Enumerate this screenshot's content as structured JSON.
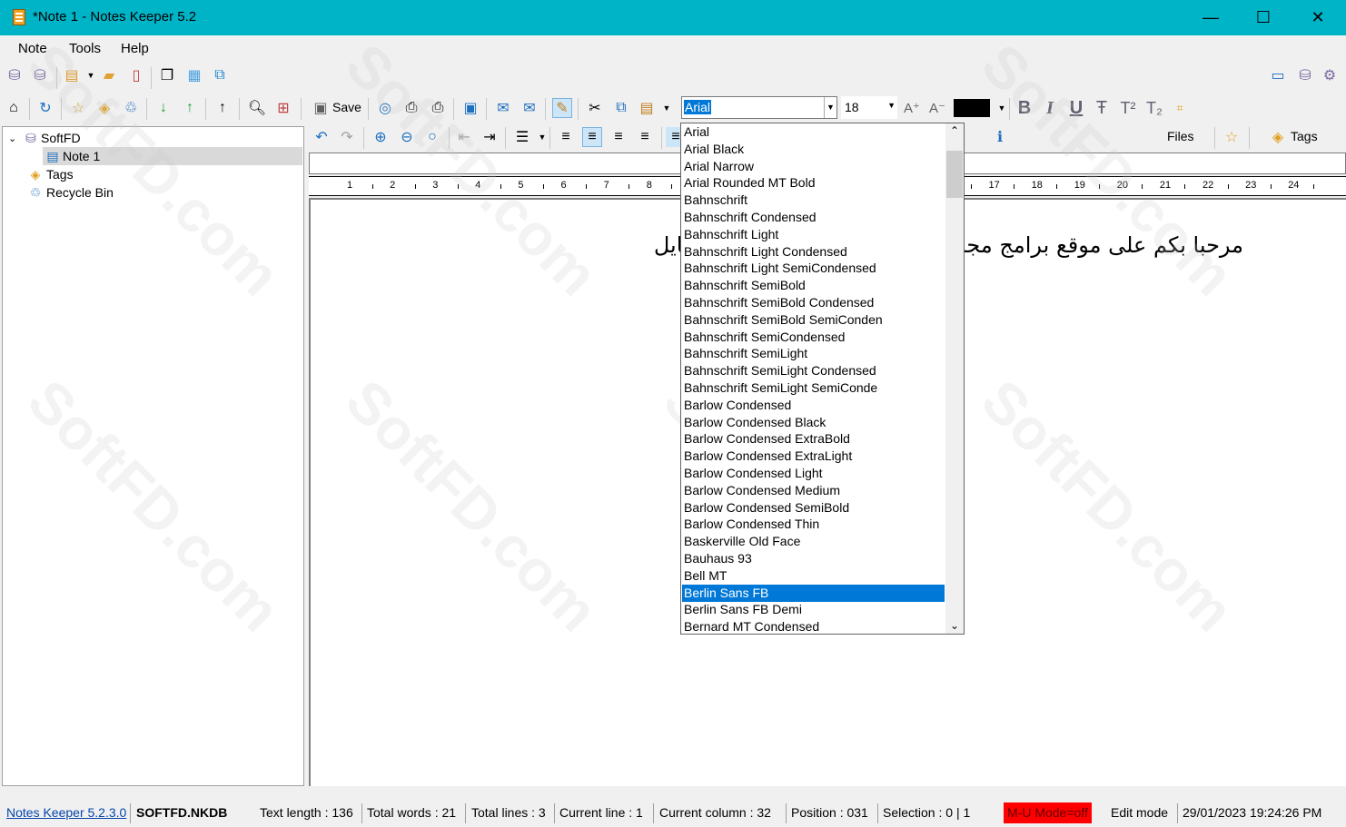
{
  "window": {
    "title": "*Note 1 - Notes Keeper 5.2",
    "minimize": "—",
    "maximize": "☐",
    "close": "✕"
  },
  "menu": {
    "items": [
      "Note",
      "Tools",
      "Help"
    ]
  },
  "toolbar": {
    "save_label": "Save",
    "files_label": "Files",
    "tags_label": "Tags"
  },
  "font": {
    "current": "Arial",
    "size": "18"
  },
  "tree": {
    "root": "SoftFD",
    "note": "Note 1",
    "tags": "Tags",
    "recycle": "Recycle Bin"
  },
  "ruler": {
    "numbers": [
      "1",
      "2",
      "3",
      "4",
      "5",
      "6",
      "7",
      "8",
      "",
      "",
      "",
      "",
      "",
      "",
      "16",
      "17",
      "18",
      "19",
      "20",
      "21",
      "22",
      "23",
      "24"
    ]
  },
  "editor": {
    "text": "مرحبا بكم على موقع برامج مجانية ت المجانية للكمبيوتر والموبايل"
  },
  "font_list": {
    "items": [
      "Arial",
      "Arial Black",
      "Arial Narrow",
      "Arial Rounded MT Bold",
      "Bahnschrift",
      "Bahnschrift Condensed",
      "Bahnschrift Light",
      "Bahnschrift Light Condensed",
      "Bahnschrift Light SemiCondensed",
      "Bahnschrift SemiBold",
      "Bahnschrift SemiBold Condensed",
      "Bahnschrift SemiBold SemiConden",
      "Bahnschrift SemiCondensed",
      "Bahnschrift SemiLight",
      "Bahnschrift SemiLight Condensed",
      "Bahnschrift SemiLight SemiConde",
      "Barlow Condensed",
      "Barlow Condensed Black",
      "Barlow Condensed ExtraBold",
      "Barlow Condensed ExtraLight",
      "Barlow Condensed Light",
      "Barlow Condensed Medium",
      "Barlow Condensed SemiBold",
      "Barlow Condensed Thin",
      "Baskerville Old Face",
      "Bauhaus 93",
      "Bell MT",
      "Berlin Sans FB",
      "Berlin Sans FB Demi",
      "Bernard MT Condensed"
    ],
    "selected": "Berlin Sans FB"
  },
  "status": {
    "version_link": "Notes Keeper 5.2.3.0",
    "db": "SOFTFD.NKDB",
    "text_length": "Text length : 136",
    "total_words": "Total words : 21",
    "total_lines": "Total lines : 3",
    "current_line": "Current line : 1",
    "current_column": "Current column : 32",
    "position": "Position : 031",
    "selection": "Selection : 0 | 1",
    "mu_mode": "M-U Mode=off",
    "edit_mode": "Edit mode",
    "datetime": "29/01/2023 19:24:26 PM"
  },
  "watermark": "SoftFD.com",
  "colors": {
    "titlebar": "#00b4c8",
    "selection": "#0078d7",
    "mu_mode_bg": "#ff0000"
  }
}
